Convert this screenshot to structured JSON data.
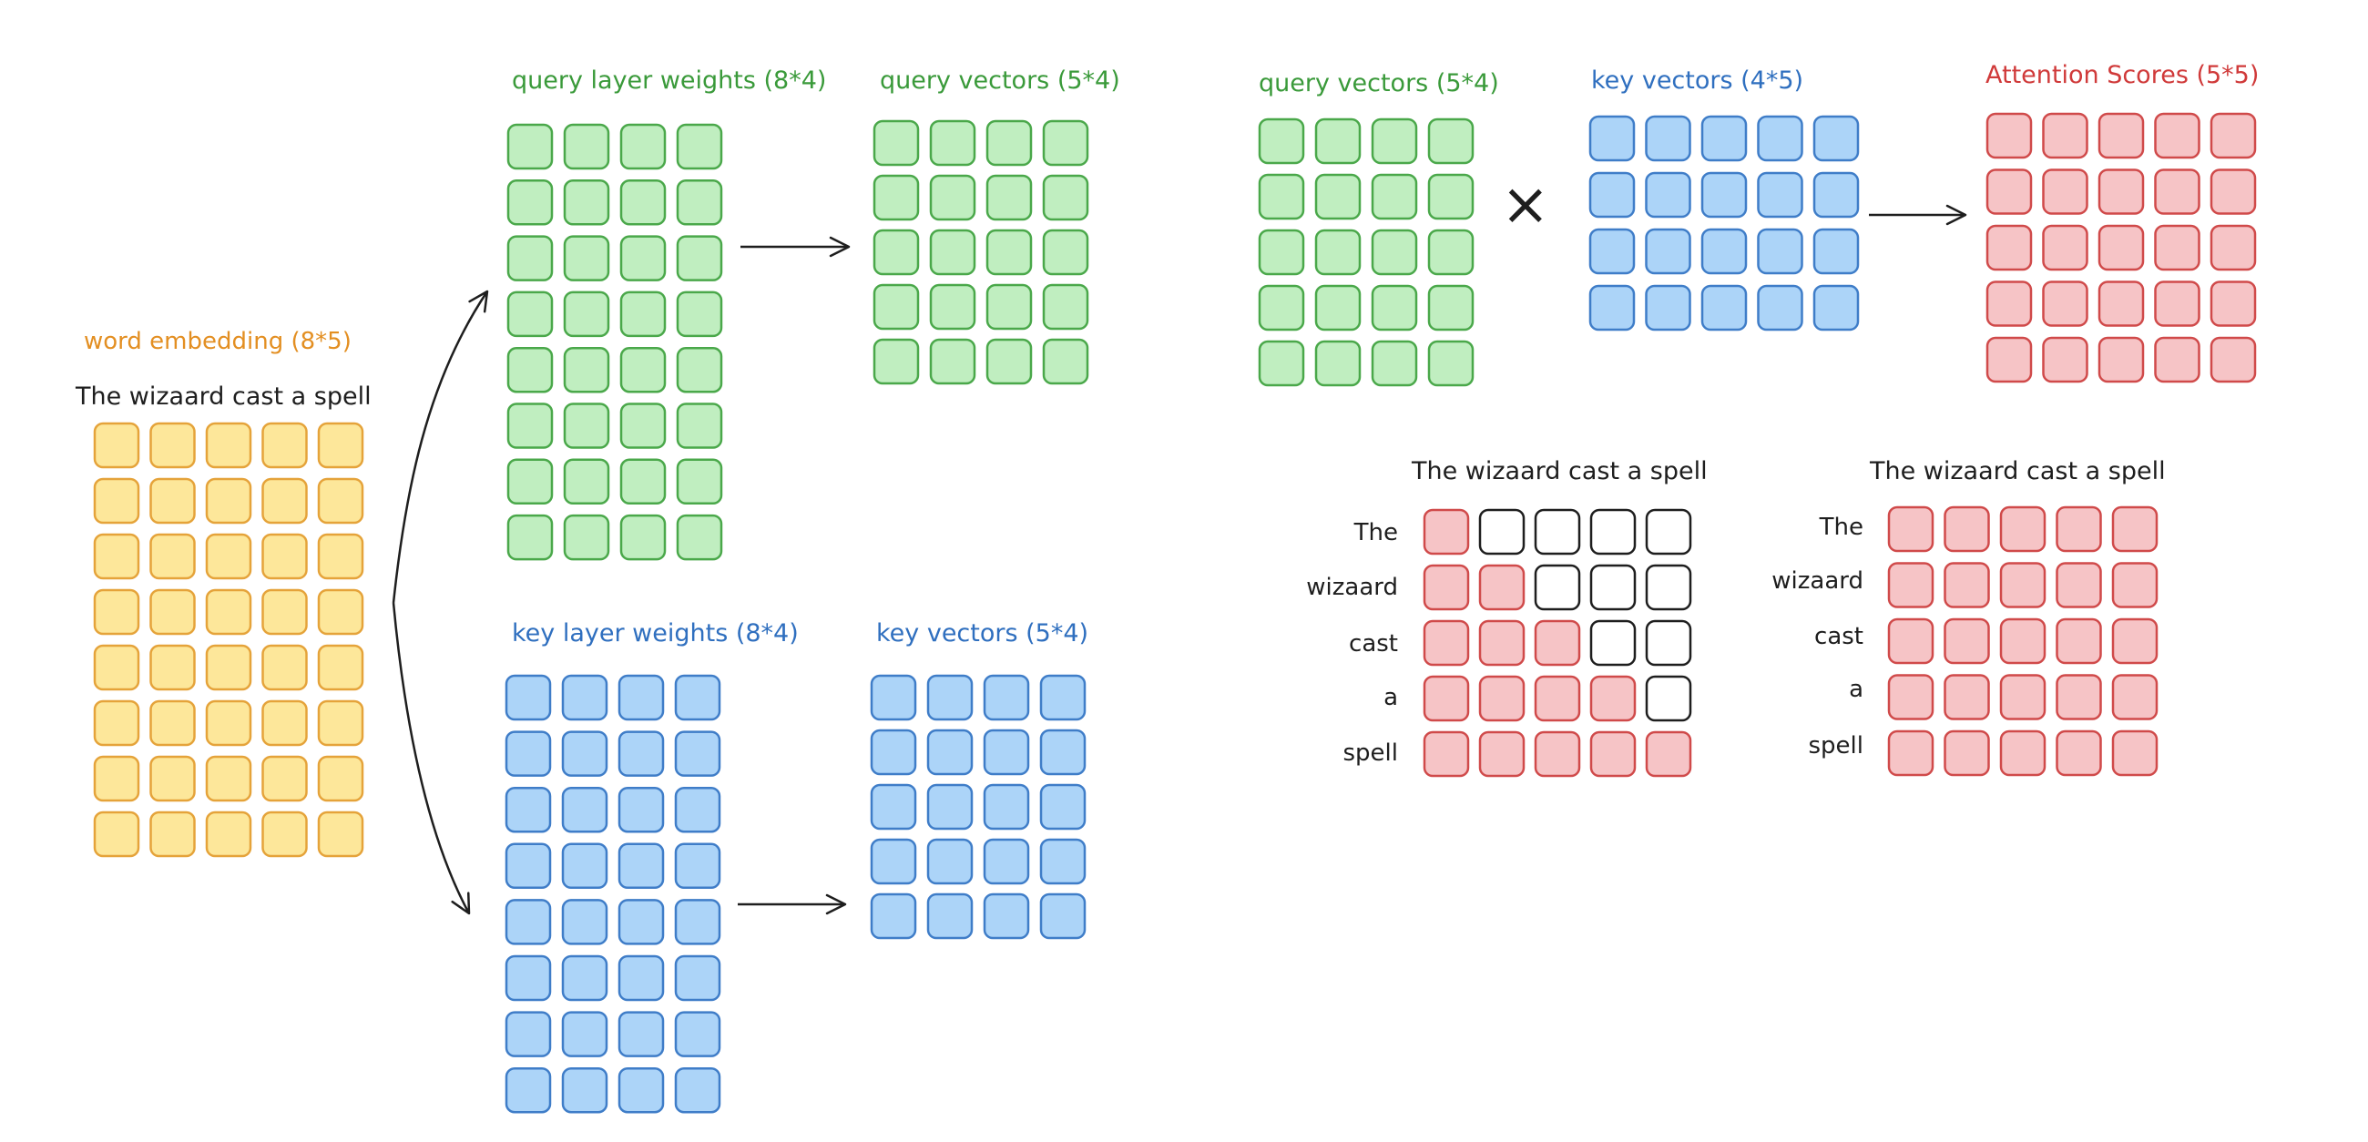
{
  "colors": {
    "yellow": {
      "fill": "#fde79a",
      "stroke": "#e5a33a"
    },
    "green": {
      "fill": "#c0eec0",
      "stroke": "#4aa84a"
    },
    "blue": {
      "fill": "#acd4f8",
      "stroke": "#3f7dc8"
    },
    "red": {
      "fill": "#f6c4c6",
      "stroke": "#d04a4a"
    },
    "empty": {
      "fill": "#ffffff",
      "stroke": "#1e1e1e"
    },
    "arrow": "#1e1e1e",
    "word_color": "#1e1e1e"
  },
  "word_embedding": {
    "title": "word embedding (8*5)",
    "sentence": "The wizaard cast a spell",
    "rows": 8,
    "cols": 5
  },
  "query_weights": {
    "title": "query layer weights (8*4)",
    "rows": 8,
    "cols": 4
  },
  "query_vectors_left": {
    "title": "query vectors (5*4)",
    "rows": 5,
    "cols": 4
  },
  "key_weights": {
    "title": "key layer weights (8*4)",
    "rows": 8,
    "cols": 4
  },
  "key_vectors_left": {
    "title": "key vectors (5*4)",
    "rows": 5,
    "cols": 4
  },
  "query_vectors_right": {
    "title": "query vectors (5*4)",
    "rows": 5,
    "cols": 4
  },
  "multiply_symbol": "×",
  "key_vectors_right": {
    "title": "key vectors (4*5)",
    "rows": 4,
    "cols": 5
  },
  "attention_scores": {
    "title": "Attention Scores (5*5)",
    "rows": 5,
    "cols": 5
  },
  "masked_matrix": {
    "header": "The wizaard cast a spell",
    "row_labels": [
      "The",
      "wizaard",
      "cast",
      "a",
      "spell"
    ],
    "filled_per_row": [
      1,
      2,
      3,
      4,
      5
    ]
  },
  "full_matrix": {
    "header": "The wizaard cast a spell",
    "row_labels": [
      "The",
      "wizaard",
      "cast",
      "a",
      "spell"
    ]
  }
}
